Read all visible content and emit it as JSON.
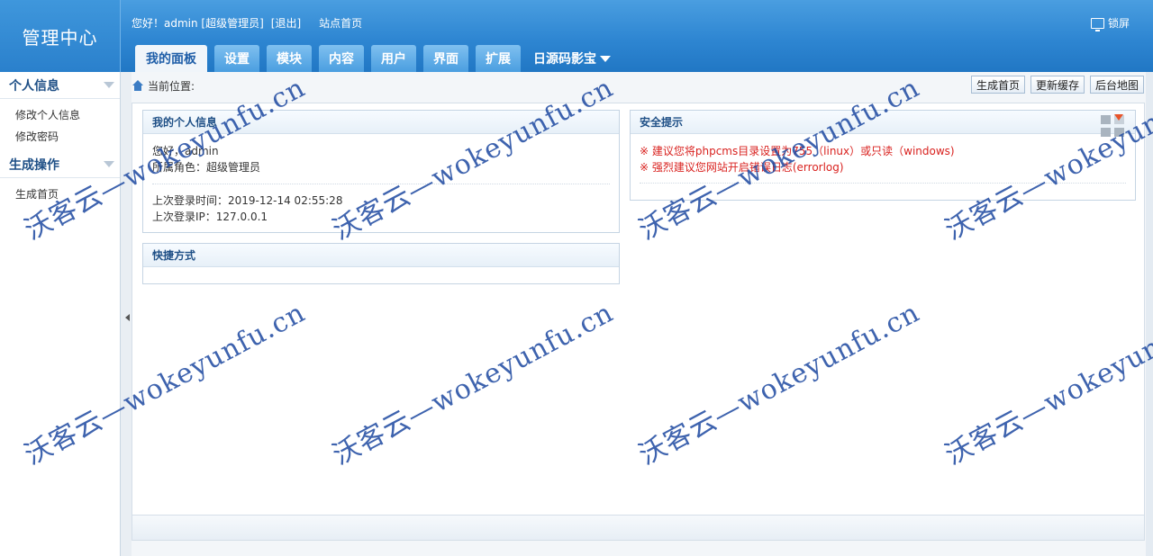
{
  "header": {
    "logo": "管理中心",
    "greeting": "您好！admin [超级管理员]",
    "logout": "[退出]",
    "site_home": "站点首页",
    "lock": "锁屏"
  },
  "nav": {
    "tabs": [
      "我的面板",
      "设置",
      "模块",
      "内容",
      "用户",
      "界面",
      "扩展"
    ],
    "more": "日源码影宝"
  },
  "sidebar": {
    "section1": {
      "title": "个人信息",
      "items": [
        "修改个人信息",
        "修改密码"
      ]
    },
    "section2": {
      "title": "生成操作",
      "items": [
        "生成首页"
      ]
    }
  },
  "breadcrumb": {
    "label": "当前位置:"
  },
  "actions": {
    "gen_home": "生成首页",
    "update_cache": "更新缓存",
    "site_map": "后台地图"
  },
  "my_info": {
    "title": "我的个人信息",
    "hello": "您好，admin",
    "role": "所属角色：超级管理员",
    "last_login_time": "上次登录时间：2019-12-14 02:55:28",
    "last_login_ip": "上次登录IP：127.0.0.1"
  },
  "shortcuts": {
    "title": "快捷方式"
  },
  "security": {
    "title": "安全提示",
    "tip1": "※ 建议您将phpcms目录设置为755（linux）或只读（windows)",
    "tip2": "※ 强烈建议您网站开启错误日志(errorlog)"
  },
  "watermark": {
    "a": "沃客云—wokeyunfu.cn"
  },
  "colors": {
    "header_blue": "#2e86d2",
    "warn_red": "#d9221f",
    "title_blue": "#1e4f86"
  }
}
